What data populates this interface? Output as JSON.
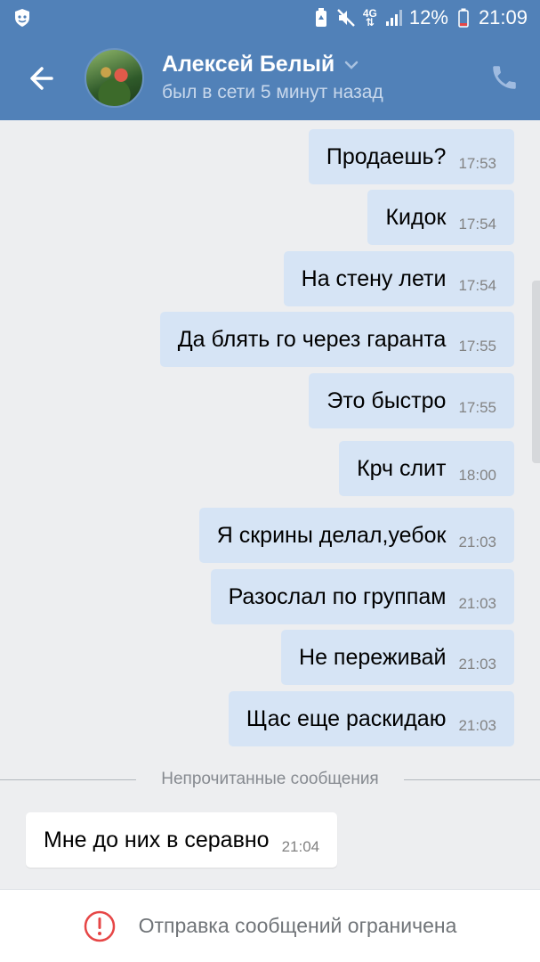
{
  "status_bar": {
    "network": "4G",
    "battery": "12%",
    "time": "21:09"
  },
  "header": {
    "name": "Алексей Белый",
    "status": "был в сети 5 минут назад"
  },
  "messages": [
    {
      "text": "Продаешь?",
      "time": "17:53"
    },
    {
      "text": "Кидок",
      "time": "17:54"
    },
    {
      "text": "На стену лети",
      "time": "17:54"
    },
    {
      "text": "Да блять го через гаранта",
      "time": "17:55"
    },
    {
      "text": "Это быстро",
      "time": "17:55"
    },
    {
      "text": "Крч слит",
      "time": "18:00"
    },
    {
      "text": "Я скрины делал,уебок",
      "time": "21:03"
    },
    {
      "text": "Разослал по группам",
      "time": "21:03"
    },
    {
      "text": "Не переживай",
      "time": "21:03"
    },
    {
      "text": "Щас еще раскидаю",
      "time": "21:03"
    },
    {
      "text": "Мне до них в серавно",
      "time": "21:04"
    }
  ],
  "divider": {
    "label": "Непрочитанные сообщения"
  },
  "footer": {
    "notice": "Отправка сообщений ограничена"
  },
  "colors": {
    "header": "#5181b8",
    "outgoing_bubble": "#d6e4f5",
    "incoming_bubble": "#ffffff",
    "background": "#edeef0",
    "alert": "#e64646"
  }
}
